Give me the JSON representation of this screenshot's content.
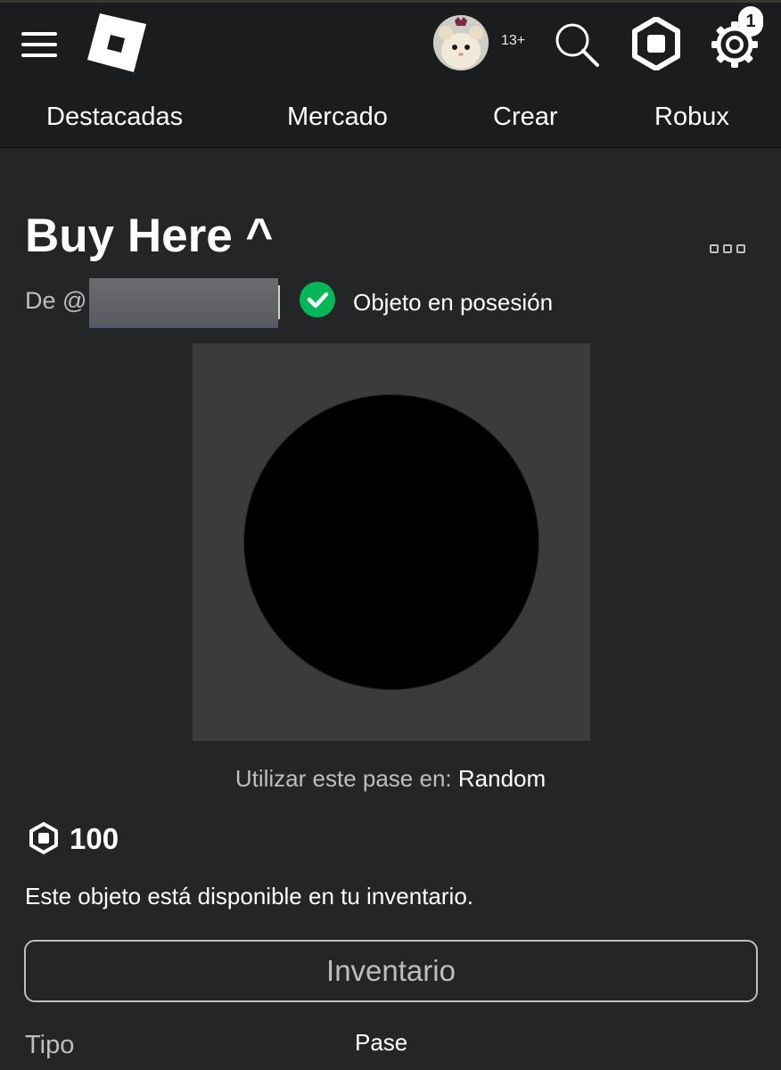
{
  "header": {
    "age_label": "13+",
    "notification_count": "1",
    "nav": [
      {
        "label": "Destacadas"
      },
      {
        "label": "Mercado"
      },
      {
        "label": "Crear"
      },
      {
        "label": "Robux"
      }
    ]
  },
  "item": {
    "title": "Buy Here ^",
    "by_prefix": "De @",
    "owned_label": "Objeto en posesión",
    "use_pass_prefix": "Utilizar este pase en:",
    "use_pass_game": "Random",
    "price": "100",
    "availability_text": "Este objeto está disponible en tu inventario.",
    "inventory_button": "Inventario",
    "details": [
      {
        "label": "Tipo",
        "value": "Pase"
      }
    ]
  },
  "colors": {
    "background": "#232527",
    "topbar": "#1b1c1e",
    "owned_green": "#02b757",
    "thumbnail_bg": "#393b3d",
    "secondary_text": "#bdbebe"
  },
  "icons": [
    "menu-icon",
    "roblox-logo",
    "avatar",
    "search-icon",
    "robux-icon",
    "settings-gear-icon",
    "more-options-icon",
    "checkmark-icon"
  ]
}
